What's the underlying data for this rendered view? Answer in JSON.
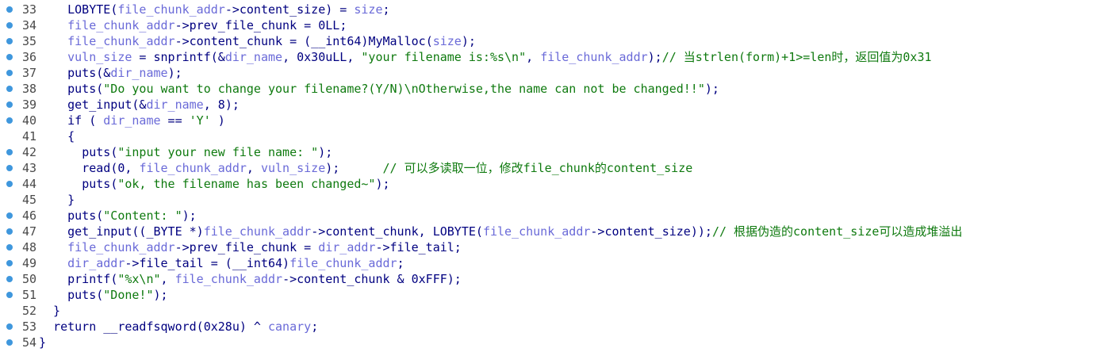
{
  "editor": {
    "lines": [
      {
        "num": "33",
        "bp": true,
        "tokens": [
          [
            "    ",
            "punc"
          ],
          [
            "LOBYTE",
            "fn"
          ],
          [
            "(",
            "punc"
          ],
          [
            "file_chunk_addr",
            "var"
          ],
          [
            "->content_size) = ",
            "punc"
          ],
          [
            "size",
            "var"
          ],
          [
            ";",
            "punc"
          ]
        ]
      },
      {
        "num": "34",
        "bp": true,
        "tokens": [
          [
            "    ",
            "punc"
          ],
          [
            "file_chunk_addr",
            "var"
          ],
          [
            "->prev_file_chunk = ",
            "punc"
          ],
          [
            "0LL",
            "num"
          ],
          [
            ";",
            "punc"
          ]
        ]
      },
      {
        "num": "35",
        "bp": true,
        "tokens": [
          [
            "    ",
            "punc"
          ],
          [
            "file_chunk_addr",
            "var"
          ],
          [
            "->content_chunk = (__int64)",
            "punc"
          ],
          [
            "MyMalloc",
            "fn"
          ],
          [
            "(",
            "punc"
          ],
          [
            "size",
            "var"
          ],
          [
            ");",
            "punc"
          ]
        ]
      },
      {
        "num": "36",
        "bp": true,
        "tokens": [
          [
            "    ",
            "punc"
          ],
          [
            "vuln_size",
            "var"
          ],
          [
            " = ",
            "punc"
          ],
          [
            "snprintf",
            "fn"
          ],
          [
            "(&",
            "punc"
          ],
          [
            "dir_name",
            "var"
          ],
          [
            ", ",
            "punc"
          ],
          [
            "0x30uLL",
            "num"
          ],
          [
            ", ",
            "punc"
          ],
          [
            "\"your filename is:%s\\n\"",
            "str"
          ],
          [
            ", ",
            "punc"
          ],
          [
            "file_chunk_addr",
            "var"
          ],
          [
            ");",
            "punc"
          ],
          [
            "// 当strlen(form)+1>=len时，返回值为0x31",
            "cmt"
          ]
        ]
      },
      {
        "num": "37",
        "bp": true,
        "tokens": [
          [
            "    ",
            "punc"
          ],
          [
            "puts",
            "fn"
          ],
          [
            "(&",
            "punc"
          ],
          [
            "dir_name",
            "var"
          ],
          [
            ");",
            "punc"
          ]
        ]
      },
      {
        "num": "38",
        "bp": true,
        "tokens": [
          [
            "    ",
            "punc"
          ],
          [
            "puts",
            "fn"
          ],
          [
            "(",
            "punc"
          ],
          [
            "\"Do you want to change your filename?(Y/N)\\nOtherwise,the name can not be changed!!\"",
            "str"
          ],
          [
            ");",
            "punc"
          ]
        ]
      },
      {
        "num": "39",
        "bp": true,
        "tokens": [
          [
            "    ",
            "punc"
          ],
          [
            "get_input",
            "fn"
          ],
          [
            "(&",
            "punc"
          ],
          [
            "dir_name",
            "var"
          ],
          [
            ", ",
            "punc"
          ],
          [
            "8",
            "num"
          ],
          [
            ");",
            "punc"
          ]
        ]
      },
      {
        "num": "40",
        "bp": true,
        "tokens": [
          [
            "    ",
            "punc"
          ],
          [
            "if",
            "kw"
          ],
          [
            " ( ",
            "punc"
          ],
          [
            "dir_name",
            "var"
          ],
          [
            " == ",
            "punc"
          ],
          [
            "'Y'",
            "str"
          ],
          [
            " )",
            "punc"
          ]
        ]
      },
      {
        "num": "41",
        "bp": false,
        "tokens": [
          [
            "    {",
            "punc"
          ]
        ]
      },
      {
        "num": "42",
        "bp": true,
        "tokens": [
          [
            "      ",
            "punc"
          ],
          [
            "puts",
            "fn"
          ],
          [
            "(",
            "punc"
          ],
          [
            "\"input your new file name: \"",
            "str"
          ],
          [
            ");",
            "punc"
          ]
        ]
      },
      {
        "num": "43",
        "bp": true,
        "tokens": [
          [
            "      ",
            "punc"
          ],
          [
            "read",
            "fn"
          ],
          [
            "(",
            "punc"
          ],
          [
            "0",
            "num"
          ],
          [
            ", ",
            "punc"
          ],
          [
            "file_chunk_addr",
            "var"
          ],
          [
            ", ",
            "punc"
          ],
          [
            "vuln_size",
            "var"
          ],
          [
            ");      ",
            "punc"
          ],
          [
            "// 可以多读取一位，修改file_chunk的content_size",
            "cmt"
          ]
        ]
      },
      {
        "num": "44",
        "bp": true,
        "tokens": [
          [
            "      ",
            "punc"
          ],
          [
            "puts",
            "fn"
          ],
          [
            "(",
            "punc"
          ],
          [
            "\"ok, the filename has been changed~\"",
            "str"
          ],
          [
            ");",
            "punc"
          ]
        ]
      },
      {
        "num": "45",
        "bp": false,
        "tokens": [
          [
            "    }",
            "punc"
          ]
        ]
      },
      {
        "num": "46",
        "bp": true,
        "tokens": [
          [
            "    ",
            "punc"
          ],
          [
            "puts",
            "fn"
          ],
          [
            "(",
            "punc"
          ],
          [
            "\"Content: \"",
            "str"
          ],
          [
            ");",
            "punc"
          ]
        ]
      },
      {
        "num": "47",
        "bp": true,
        "tokens": [
          [
            "    ",
            "punc"
          ],
          [
            "get_input",
            "fn"
          ],
          [
            "((_BYTE *)",
            "punc"
          ],
          [
            "file_chunk_addr",
            "var"
          ],
          [
            "->content_chunk, ",
            "punc"
          ],
          [
            "LOBYTE",
            "fn"
          ],
          [
            "(",
            "punc"
          ],
          [
            "file_chunk_addr",
            "var"
          ],
          [
            "->content_size));",
            "punc"
          ],
          [
            "// 根据伪造的content_size可以造成堆溢出",
            "cmt"
          ]
        ]
      },
      {
        "num": "48",
        "bp": true,
        "tokens": [
          [
            "    ",
            "punc"
          ],
          [
            "file_chunk_addr",
            "var"
          ],
          [
            "->prev_file_chunk = ",
            "punc"
          ],
          [
            "dir_addr",
            "var"
          ],
          [
            "->file_tail;",
            "punc"
          ]
        ]
      },
      {
        "num": "49",
        "bp": true,
        "tokens": [
          [
            "    ",
            "punc"
          ],
          [
            "dir_addr",
            "var"
          ],
          [
            "->file_tail = (__int64)",
            "punc"
          ],
          [
            "file_chunk_addr",
            "var"
          ],
          [
            ";",
            "punc"
          ]
        ]
      },
      {
        "num": "50",
        "bp": true,
        "tokens": [
          [
            "    ",
            "punc"
          ],
          [
            "printf",
            "fn"
          ],
          [
            "(",
            "punc"
          ],
          [
            "\"%x\\n\"",
            "str"
          ],
          [
            ", ",
            "punc"
          ],
          [
            "file_chunk_addr",
            "var"
          ],
          [
            "->content_chunk & ",
            "punc"
          ],
          [
            "0xFFF",
            "num"
          ],
          [
            ");",
            "punc"
          ]
        ]
      },
      {
        "num": "51",
        "bp": true,
        "tokens": [
          [
            "    ",
            "punc"
          ],
          [
            "puts",
            "fn"
          ],
          [
            "(",
            "punc"
          ],
          [
            "\"Done!\"",
            "str"
          ],
          [
            ");",
            "punc"
          ]
        ]
      },
      {
        "num": "52",
        "bp": false,
        "tokens": [
          [
            "  }",
            "punc"
          ]
        ]
      },
      {
        "num": "53",
        "bp": true,
        "tokens": [
          [
            "  ",
            "punc"
          ],
          [
            "return",
            "kw"
          ],
          [
            " __readfsqword(",
            "punc"
          ],
          [
            "0x28u",
            "num"
          ],
          [
            ") ^ ",
            "punc"
          ],
          [
            "canary",
            "var"
          ],
          [
            ";",
            "punc"
          ]
        ]
      },
      {
        "num": "54",
        "bp": true,
        "tokens": [
          [
            "}",
            "punc"
          ]
        ]
      }
    ]
  }
}
